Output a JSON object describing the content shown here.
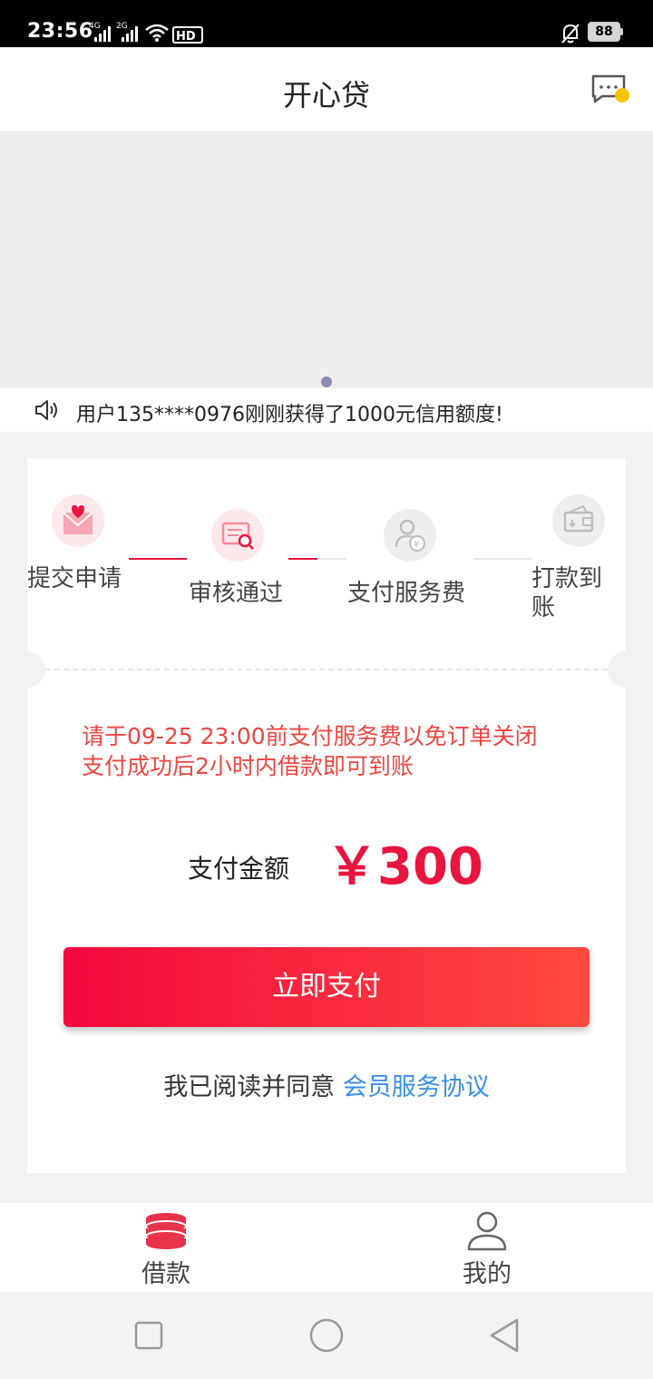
{
  "status_bar": {
    "time": "23:56",
    "signal1_label": "4G",
    "signal2_label": "2G",
    "battery": "88"
  },
  "header": {
    "title": "开心贷",
    "message_icon": "chat-bubble-icon",
    "badge_color": "#f5c400"
  },
  "notice": {
    "icon": "speaker-icon",
    "text": "用户135****0976刚刚获得了1000元信用额度!"
  },
  "steps": [
    {
      "label": "提交申请",
      "icon": "envelope-heart-icon",
      "active": true
    },
    {
      "label": "审核通过",
      "icon": "review-search-icon",
      "active": true
    },
    {
      "label": "支付服务费",
      "icon": "user-yuan-icon",
      "active": false
    },
    {
      "label": "打款到账",
      "icon": "wallet-icon",
      "active": false
    }
  ],
  "payment": {
    "deadline_notice": "请于09-25 23:00前支付服务费以免订单关闭",
    "arrival_notice": "支付成功后2小时内借款即可到账",
    "amount_label": "支付金额",
    "amount": "￥300",
    "pay_button": "立即支付",
    "agree_prefix": "我已阅读并同意",
    "agreement_link": "会员服务协议"
  },
  "tabs": [
    {
      "label": "借款",
      "icon": "coins-stack-icon",
      "active": true
    },
    {
      "label": "我的",
      "icon": "person-icon",
      "active": false
    }
  ],
  "colors": {
    "accent": "#e8153f",
    "warning_text": "#ee4540",
    "link": "#3a8ee6"
  }
}
